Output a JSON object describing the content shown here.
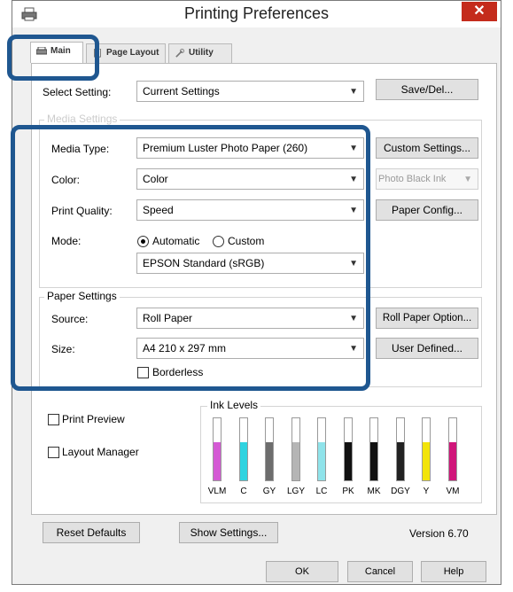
{
  "window": {
    "title": "Printing Preferences",
    "close": "✕"
  },
  "tabs": [
    {
      "label": "Main",
      "active": true
    },
    {
      "label": "Page Layout",
      "active": false
    },
    {
      "label": "Utility",
      "active": false
    }
  ],
  "select_setting": {
    "label": "Select Setting:",
    "value": "Current Settings",
    "button": "Save/Del..."
  },
  "media_settings": {
    "group_title": "Media Settings",
    "media_type": {
      "label": "Media Type:",
      "value": "Premium Luster Photo Paper (260)",
      "button": "Custom Settings..."
    },
    "color": {
      "label": "Color:",
      "value": "Color",
      "ink_value": "Photo Black Ink"
    },
    "print_quality": {
      "label": "Print Quality:",
      "value": "Speed",
      "button": "Paper Config..."
    },
    "mode": {
      "label": "Mode:",
      "automatic": "Automatic",
      "custom": "Custom",
      "selected": "Automatic",
      "profile": "EPSON Standard (sRGB)"
    }
  },
  "paper_settings": {
    "group_title": "Paper Settings",
    "source": {
      "label": "Source:",
      "value": "Roll Paper",
      "button": "Roll Paper Option..."
    },
    "size": {
      "label": "Size:",
      "value": "A4 210 x 297 mm",
      "button": "User Defined..."
    },
    "borderless": {
      "label": "Borderless",
      "checked": false
    }
  },
  "options": {
    "print_preview": {
      "label": "Print Preview",
      "checked": false
    },
    "layout_manager": {
      "label": "Layout Manager",
      "checked": false
    }
  },
  "ink_levels": {
    "title": "Ink Levels",
    "inks": [
      {
        "name": "VLM",
        "color": "#d45ad4",
        "level": 0.62
      },
      {
        "name": "C",
        "color": "#2fd3e0",
        "level": 0.62
      },
      {
        "name": "GY",
        "color": "#6d6d6d",
        "level": 0.62
      },
      {
        "name": "LGY",
        "color": "#b5b5b5",
        "level": 0.62
      },
      {
        "name": "LC",
        "color": "#8fe3ea",
        "level": 0.62
      },
      {
        "name": "PK",
        "color": "#111111",
        "level": 0.62
      },
      {
        "name": "MK",
        "color": "#111111",
        "level": 0.62
      },
      {
        "name": "DGY",
        "color": "#222222",
        "level": 0.62
      },
      {
        "name": "Y",
        "color": "#f2e40a",
        "level": 0.62
      },
      {
        "name": "VM",
        "color": "#d0167a",
        "level": 0.62
      }
    ]
  },
  "footer": {
    "reset": "Reset Defaults",
    "show": "Show Settings...",
    "version": "Version 6.70"
  },
  "dialog_buttons": {
    "ok": "OK",
    "cancel": "Cancel",
    "help": "Help"
  },
  "colors": {
    "highlight": "#1f5790",
    "close": "#c42b1c"
  }
}
